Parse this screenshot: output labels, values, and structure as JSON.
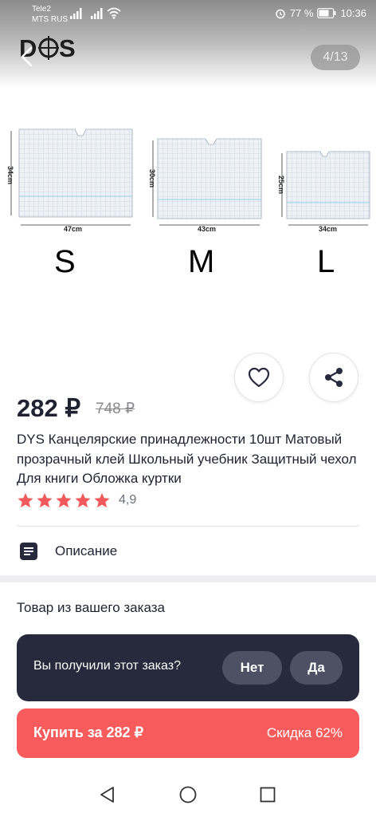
{
  "status_bar": {
    "carrier1": "Tele2",
    "carrier2": "MTS RUS",
    "battery": "77 %",
    "time": "10:36"
  },
  "gallery": {
    "brand": "DYS",
    "counter": "4/13",
    "sizes": [
      {
        "letter": "S",
        "width_label": "47cm",
        "height_label": "34cm"
      },
      {
        "letter": "M",
        "width_label": "43cm",
        "height_label": "30cm"
      },
      {
        "letter": "L",
        "width_label": "34cm",
        "height_label": "25cm"
      }
    ]
  },
  "product": {
    "price": "282 ₽",
    "old_price": "748 ₽",
    "title": "DYS Канцелярские принадлежности 10шт Матовый прозрачный клей Школьный учебник Защитный чехол Для книги Обложка куртки",
    "rating": "4,9",
    "stars": 5
  },
  "description": {
    "label": "Описание"
  },
  "order": {
    "section_title": "Товар из вашего заказа",
    "question": "Вы получили этот заказ?",
    "no_label": "Нет",
    "yes_label": "Да"
  },
  "buy_bar": {
    "buy_label": "Купить за 282 ₽",
    "discount_label": "Скидка 62%"
  },
  "colors": {
    "accent": "#f85b5b",
    "star": "#f25a5a",
    "dark_card": "#262a3c",
    "text": "#1f2230"
  },
  "icons": [
    "back-arrow-icon",
    "heart-icon",
    "share-icon",
    "star-icon",
    "document-icon",
    "nav-back-icon",
    "nav-home-icon",
    "nav-recents-icon"
  ]
}
